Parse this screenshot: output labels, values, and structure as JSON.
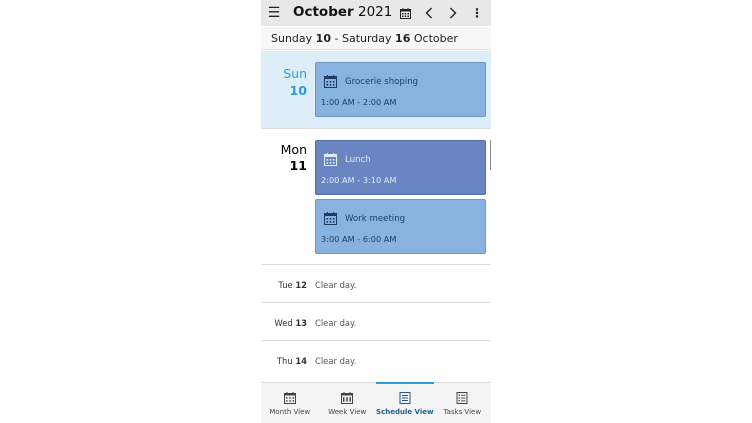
{
  "header": {
    "month": "October",
    "year": "2021",
    "menu_icon": "hamburger-menu-icon",
    "calendar_icon": "calendar-icon",
    "prev_icon": "chevron-left-icon",
    "next_icon": "chevron-right-icon",
    "more_icon": "more-vertical-icon"
  },
  "week": {
    "start_day": "Sunday",
    "start_num": "10",
    "sep": "-",
    "end_day": "Saturday",
    "end_num": "16",
    "month": "October"
  },
  "days": [
    {
      "name": "Sun",
      "num": "10",
      "today": true,
      "events": [
        {
          "title": "Grocerie shoping",
          "time": "1:00 AM - 2:00 AM"
        }
      ]
    },
    {
      "name": "Mon",
      "num": "11",
      "today": false,
      "events": [
        {
          "title": "Lunch",
          "time": "2:00 AM - 3:10 AM"
        },
        {
          "title": "Work meeting",
          "time": "3:00 AM - 6:00 AM"
        }
      ]
    }
  ],
  "clear_days": [
    {
      "name": "Tue",
      "num": "12",
      "text": "Clear day."
    },
    {
      "name": "Wed",
      "num": "13",
      "text": "Clear day."
    },
    {
      "name": "Thu",
      "num": "14",
      "text": "Clear day."
    }
  ],
  "bottom_nav": [
    {
      "label": "Month View",
      "icon": "month-view-icon",
      "active": false
    },
    {
      "label": "Week View",
      "icon": "week-view-icon",
      "active": false
    },
    {
      "label": "Schedule View",
      "icon": "schedule-view-icon",
      "active": true
    },
    {
      "label": "Tasks View",
      "icon": "tasks-view-icon",
      "active": false
    }
  ],
  "colors": {
    "accent": "#2e9bd6",
    "event_light": "#88b3e0",
    "event_dark": "#6a86c2",
    "today_bg": "#ddeef9"
  }
}
